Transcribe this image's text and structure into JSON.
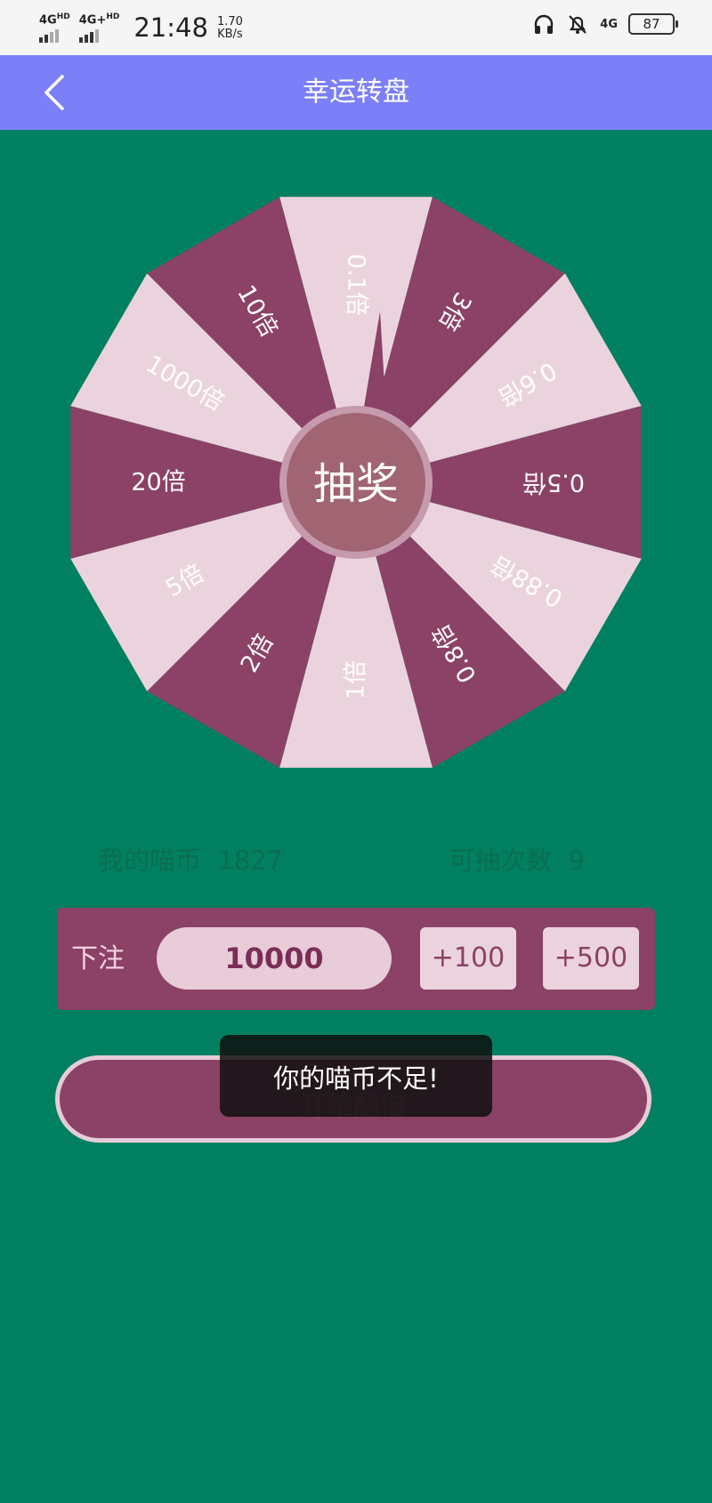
{
  "status_bar": {
    "network_1": "4G",
    "network_1_sup": "HD",
    "network_2": "4G+",
    "network_2_sup": "HD",
    "time": "21:48",
    "speed_value": "1.70",
    "speed_unit": "KB/s",
    "network_3": "4G",
    "battery": "87"
  },
  "header": {
    "title": "幸运转盘"
  },
  "wheel": {
    "center_label": "抽奖",
    "segments": [
      "0.1倍",
      "3倍",
      "0.6倍",
      "0.5倍",
      "0.88倍",
      "0.8倍",
      "1倍",
      "2倍",
      "5倍",
      "20倍",
      "1000倍",
      "10倍"
    ],
    "colors": {
      "dark": "#8b4266",
      "light": "#ebd3dd",
      "hub": "#a06472",
      "hub_ring": "#c59aad"
    }
  },
  "info": {
    "coins_label": "我的喵币",
    "coins_value": "1827",
    "draws_label": "可抽次数",
    "draws_value": "9"
  },
  "bet": {
    "label": "下注",
    "amount": "10000",
    "add_100": "+100",
    "add_500": "+500"
  },
  "start_button": {
    "label": "开始翻倍"
  },
  "toast": {
    "message": "你的喵币不足!"
  },
  "colors": {
    "background": "#008060",
    "app_bar": "#7b7ff8",
    "accent": "#8b4266"
  }
}
